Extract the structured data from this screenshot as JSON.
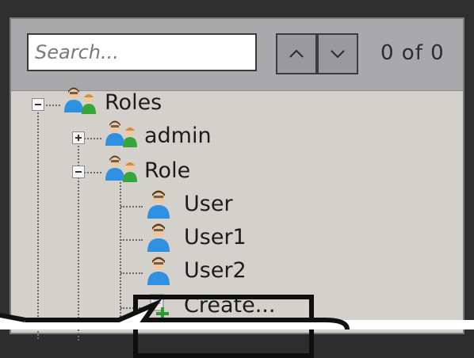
{
  "search": {
    "placeholder": "Search..."
  },
  "nav": {
    "counter": "0 of 0"
  },
  "tree": {
    "root": {
      "label": "Roles"
    },
    "groups": [
      {
        "label": "admin"
      },
      {
        "label": "Role"
      }
    ],
    "users": [
      {
        "label": "User"
      },
      {
        "label": "User1"
      },
      {
        "label": "User2"
      }
    ],
    "create": {
      "label": "Create..."
    }
  },
  "colors": {
    "panel": "#d4d0cb",
    "toolbar": "#a9a9ac",
    "highlight": "#0e0e0e",
    "user_shirt": "#2f8fe0",
    "admin_shirt": "#35a53c"
  }
}
